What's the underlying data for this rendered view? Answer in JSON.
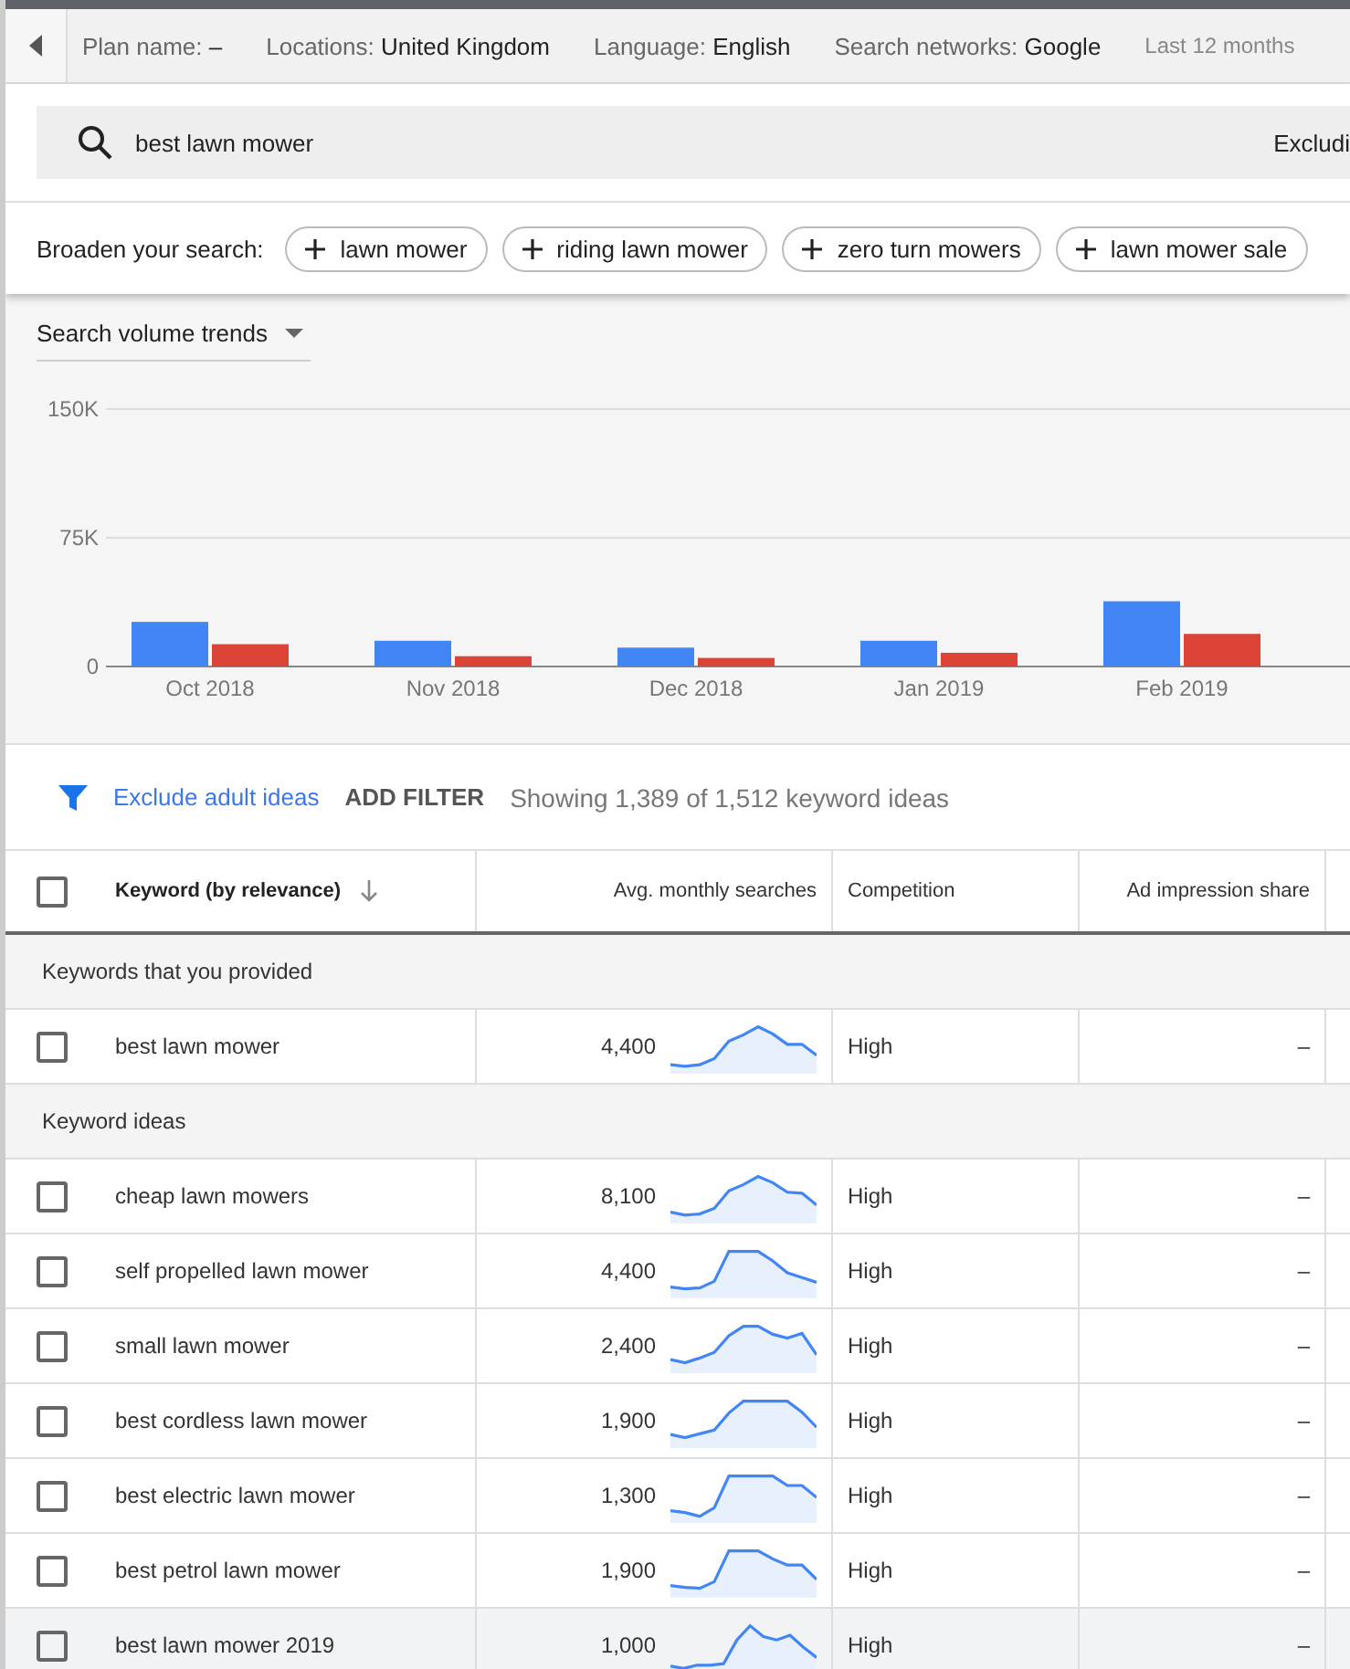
{
  "toolbar": {
    "items": [
      {
        "label": "Plan name:",
        "value": "–"
      },
      {
        "label": "Locations:",
        "value": "United Kingdom"
      },
      {
        "label": "Language:",
        "value": "English"
      },
      {
        "label": "Search networks:",
        "value": "Google"
      }
    ],
    "date_range": "Last 12 months"
  },
  "search": {
    "value": "best lawn mower",
    "exclude_label": "Excludi"
  },
  "broaden": {
    "label": "Broaden your search:",
    "chips": [
      "lawn mower",
      "riding lawn mower",
      "zero turn mowers",
      "lawn mower sale"
    ]
  },
  "trends": {
    "selector": "Search volume trends",
    "chart_data": {
      "type": "bar",
      "categories": [
        "Oct 2018",
        "Nov 2018",
        "Dec 2018",
        "Jan 2019",
        "Feb 2019"
      ],
      "series": [
        {
          "color": "#4285f4",
          "values": [
            26000,
            15000,
            11000,
            15000,
            38000
          ]
        },
        {
          "color": "#db4437",
          "values": [
            13000,
            6000,
            5000,
            8000,
            19000
          ]
        }
      ],
      "ylim": [
        0,
        150000
      ],
      "yticks": [
        {
          "value": 0,
          "label": "0"
        },
        {
          "value": 75000,
          "label": "75K"
        },
        {
          "value": 150000,
          "label": "150K"
        }
      ]
    }
  },
  "filter_bar": {
    "exclude_link": "Exclude adult ideas",
    "add_filter": "ADD FILTER",
    "summary": "Showing 1,389 of 1,512 keyword ideas"
  },
  "table": {
    "select_all_checked": false,
    "columns": [
      {
        "label": "Keyword (by relevance)",
        "sorted": true
      },
      {
        "label": "Avg. monthly searches",
        "sorted": false
      },
      {
        "label": "Competition",
        "sorted": false
      },
      {
        "label": "Ad impression share",
        "sorted": false
      }
    ],
    "groups": [
      {
        "title": "Keywords that you provided",
        "rows": [
          {
            "keyword": "best lawn mower",
            "searches": "4,400",
            "competition": "High",
            "ad_share": "–",
            "checked": false,
            "highlighted": false
          }
        ]
      },
      {
        "title": "Keyword ideas",
        "rows": [
          {
            "keyword": "cheap lawn mowers",
            "searches": "8,100",
            "competition": "High",
            "ad_share": "–",
            "checked": false,
            "highlighted": false
          },
          {
            "keyword": "self propelled lawn mower",
            "searches": "4,400",
            "competition": "High",
            "ad_share": "–",
            "checked": false,
            "highlighted": false
          },
          {
            "keyword": "small lawn mower",
            "searches": "2,400",
            "competition": "High",
            "ad_share": "–",
            "checked": false,
            "highlighted": false
          },
          {
            "keyword": "best cordless lawn mower",
            "searches": "1,900",
            "competition": "High",
            "ad_share": "–",
            "checked": false,
            "highlighted": false
          },
          {
            "keyword": "best electric lawn mower",
            "searches": "1,300",
            "competition": "High",
            "ad_share": "–",
            "checked": false,
            "highlighted": false
          },
          {
            "keyword": "best petrol lawn mower",
            "searches": "1,900",
            "competition": "High",
            "ad_share": "–",
            "checked": false,
            "highlighted": false
          },
          {
            "keyword": "best lawn mower 2019",
            "searches": "1,000",
            "competition": "High",
            "ad_share": "–",
            "checked": false,
            "highlighted": true
          }
        ]
      }
    ]
  }
}
